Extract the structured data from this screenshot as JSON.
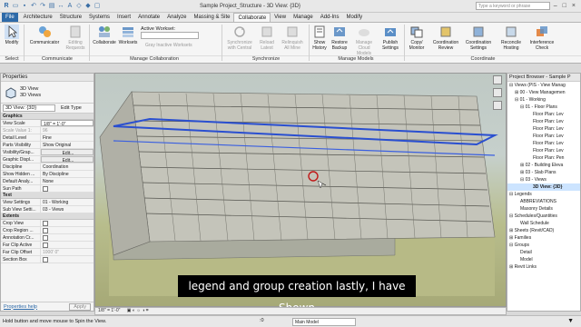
{
  "window": {
    "title": "Sample Project_Structure - 3D View: {3D}",
    "search_placeholder": "Type a keyword or phrase"
  },
  "tabs": [
    "File",
    "Architecture",
    "Structure",
    "Systems",
    "Insert",
    "Annotate",
    "Analyze",
    "Massing & Site",
    "Collaborate",
    "View",
    "Manage",
    "Add-Ins",
    "Modify"
  ],
  "ribbon": {
    "modify": "Modify",
    "select": "Select",
    "communicator": "Communicator",
    "editing_requests": "Editing Requests",
    "communicate_panel": "Communicate",
    "collaborate": "Collaborate",
    "active_workset_label": "Active Workset:",
    "worksets": "Worksets",
    "gray_inactive": "Gray Inactive Worksets",
    "manage_collab_panel": "Manage Collaboration",
    "sync_central": "Synchronize with Central",
    "reload_latest": "Reload Latest",
    "relinquish_all": "Relinquish All Mine",
    "synchronize_panel": "Synchronize",
    "show_history": "Show History",
    "restore_backup": "Restore Backup",
    "manage_cloud": "Manage Cloud Models",
    "publish_settings": "Publish Settings",
    "manage_models_panel": "Manage Models",
    "copy_monitor": "Copy/ Monitor",
    "coordination_review": "Coordination Review",
    "coordination_settings": "Coordination Settings",
    "reconcile_hosting": "Reconcile Hosting",
    "interference_check": "Interference Check",
    "coordinate_panel": "Coordinate"
  },
  "properties": {
    "header": "Properties",
    "type_line1": "3D View",
    "type_line2": "3D Views",
    "selector": "3D View: {3D}",
    "edit_type": "Edit Type",
    "groups": {
      "graphics": "Graphics",
      "text": "Text",
      "extents": "Extents"
    },
    "rows": {
      "view_scale": [
        "View Scale",
        "1/8\" = 1'-0\""
      ],
      "scale_value": [
        "Scale Value 1:",
        "96"
      ],
      "detail_level": [
        "Detail Level",
        "Fine"
      ],
      "parts_visibility": [
        "Parts Visibility",
        "Show Original"
      ],
      "vg": [
        "Visibility/Grap...",
        "Edit..."
      ],
      "gd": [
        "Graphic Displ...",
        "Edit..."
      ],
      "discipline": [
        "Discipline",
        "Coordination"
      ],
      "show_hidden": [
        "Show Hidden ...",
        "By Discipline"
      ],
      "default_analysis": [
        "Default Analy...",
        "None"
      ],
      "sun_path": [
        "Sun Path",
        ""
      ],
      "view_settings": [
        "View Settings",
        "01 - Working"
      ],
      "sub_view": [
        "Sub View Setti...",
        "03 - Views"
      ],
      "crop_view": [
        "Crop View",
        ""
      ],
      "crop_region": [
        "Crop Region ...",
        ""
      ],
      "annotation_crop": [
        "Annotation Cr...",
        ""
      ],
      "far_clip_active": [
        "Far Clip Active",
        ""
      ],
      "far_clip_offset": [
        "Far Clip Offset",
        "1000' 0\""
      ],
      "section_box": [
        "Section Box",
        ""
      ]
    },
    "help": "Properties help",
    "apply": "Apply"
  },
  "browser": {
    "header": "Project Browser - Sample P",
    "items": [
      "Views (PIS - View Manag",
      "00 - View Managemen",
      "01 - Working",
      "01 - Floor Plans",
      "Floor Plan: Lev",
      "Floor Plan: Lev",
      "Floor Plan: Lev",
      "Floor Plan: Lev",
      "Floor Plan: Lev",
      "Floor Plan: Lev",
      "Floor Plan: Pen",
      "02 - Building Eleva",
      "03 - Slab Plans",
      "03 - Views",
      "3D View: {3D}",
      "Legends",
      "ABBREVIATIONS",
      "Masonry Details",
      "Schedules/Quantities",
      "Wall Schedule",
      "Sheets (Revit/CAD)",
      "Families",
      "Groups",
      "Detail",
      "Model",
      "Revit Links"
    ]
  },
  "viewport": {
    "scale_label": "1/8\" = 1'-0\""
  },
  "caption": "legend and group creation lastly, I have Shown",
  "status": {
    "hint": "Hold button and move mouse to Spin the View.",
    "zero": ":0",
    "model": "Main Model"
  }
}
